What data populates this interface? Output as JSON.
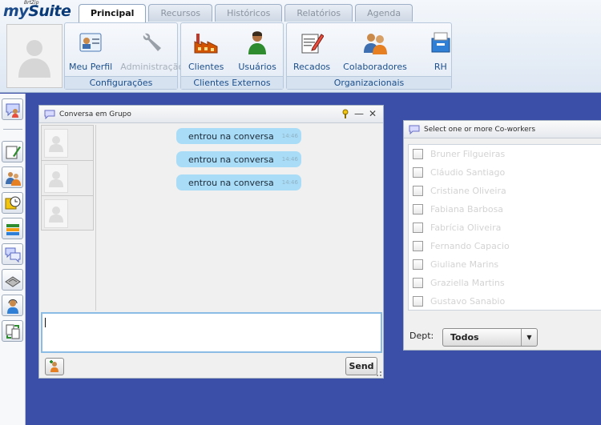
{
  "app": {
    "logo_tag": "BrtZip",
    "logo_prefix": "my",
    "logo_suffix": "Suite"
  },
  "tabs": [
    "Principal",
    "Recursos",
    "Históricos",
    "Relatórios",
    "Agenda"
  ],
  "ribbon": {
    "groups": [
      {
        "caption": "Configurações",
        "buttons": [
          {
            "label": "Meu Perfil",
            "icon": "profile-card-icon"
          },
          {
            "label": "Administração",
            "icon": "tools-icon",
            "disabled": true
          }
        ]
      },
      {
        "caption": "Clientes Externos",
        "buttons": [
          {
            "label": "Clientes",
            "icon": "factory-icon"
          },
          {
            "label": "Usuários",
            "icon": "user-icon"
          }
        ]
      },
      {
        "caption": "Organizacionais",
        "buttons": [
          {
            "label": "Recados",
            "icon": "notepad-icon"
          },
          {
            "label": "Colaboradores",
            "icon": "people-icon"
          },
          {
            "label": "RH",
            "icon": "folder-box-icon"
          }
        ]
      }
    ]
  },
  "chat": {
    "title": "Conversa em Grupo",
    "messages": [
      {
        "text": "entrou na conversa",
        "time": "14:46"
      },
      {
        "text": "entrou na conversa",
        "time": "14:46"
      },
      {
        "text": "entrou na conversa",
        "time": "14:46"
      }
    ],
    "send_label": "Send"
  },
  "coworkers": {
    "title": "Select one or more Co-workers",
    "names": [
      "Bruner Filgueiras",
      "Cláudio Santiago",
      "Cristiane Oliveira",
      "Fabiana Barbosa",
      "Fabrícia Oliveira",
      "Fernando Capacio",
      "Giuliane Marins",
      "Graziella Martins",
      "Gustavo Sanabio"
    ],
    "dept_label": "Dept:",
    "dept_value": "Todos"
  },
  "colors": {
    "desktop": "#3b4fa8",
    "bubble": "#a9dcf6",
    "accent": "#1b4f8c"
  }
}
